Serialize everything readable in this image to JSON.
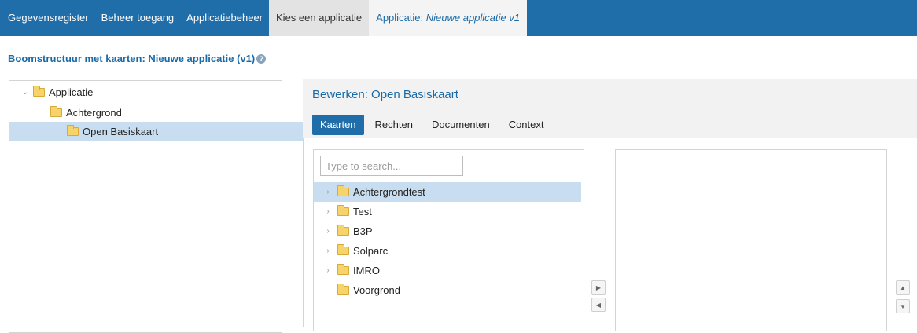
{
  "topnav": {
    "items": [
      "Gegevensregister",
      "Beheer toegang",
      "Applicatiebeheer"
    ],
    "choose_app": "Kies een applicatie",
    "app_prefix": "Applicatie: ",
    "app_name": "Nieuwe applicatie v1"
  },
  "page_title": "Boomstructuur met kaarten: Nieuwe applicatie (v1)",
  "tree": {
    "items": [
      {
        "label": "Applicatie",
        "expanded": true
      },
      {
        "label": "Achtergrond"
      },
      {
        "label": "Open Basiskaart",
        "selected": true
      }
    ]
  },
  "editor": {
    "title": "Bewerken: Open Basiskaart",
    "tabs": [
      "Kaarten",
      "Rechten",
      "Documenten",
      "Context"
    ],
    "active_tab": "Kaarten"
  },
  "available": {
    "search_placeholder": "Type to search...",
    "items": [
      {
        "label": "Achtergrondtest",
        "expandable": true,
        "selected": true
      },
      {
        "label": "Test",
        "expandable": true
      },
      {
        "label": "B3P",
        "expandable": true
      },
      {
        "label": "Solparc",
        "expandable": true
      },
      {
        "label": "IMRO",
        "expandable": true
      },
      {
        "label": "Voorgrond",
        "expandable": false
      }
    ]
  },
  "colors": {
    "nav_bg": "#1f6eaa",
    "accent": "#1a6aa8",
    "selected_row": "#c8ddef"
  }
}
